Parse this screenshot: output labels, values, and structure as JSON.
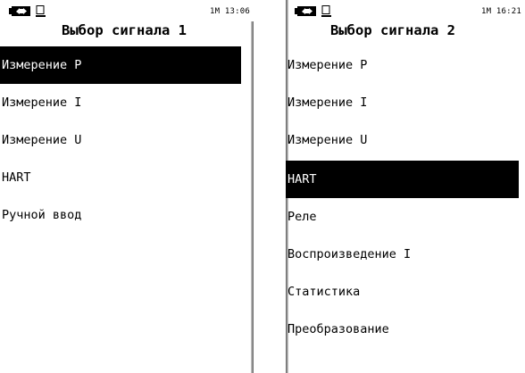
{
  "screens": [
    {
      "status": {
        "info": "1M 13:06"
      },
      "title": "Выбор сигнала 1",
      "items": [
        "Измерение P",
        "Измерение I",
        "Измерение U",
        "HART",
        "Ручной ввод"
      ],
      "selected_index": 0
    },
    {
      "status": {
        "info": "1M 16:21"
      },
      "title": "Выбор сигнала 2",
      "items": [
        "Измерение P",
        "Измерение I",
        "Измерение U",
        "HART",
        "Реле",
        "Воспроизведение I",
        "Статистика",
        "Преобразование"
      ],
      "selected_index": 3
    }
  ],
  "icons": {
    "battery": "battery-icon",
    "pc": "pc-connection-icon"
  },
  "colors": {
    "selection_bg": "#000000",
    "selection_fg": "#ffffff",
    "background": "#ffffff",
    "text": "#000000"
  }
}
